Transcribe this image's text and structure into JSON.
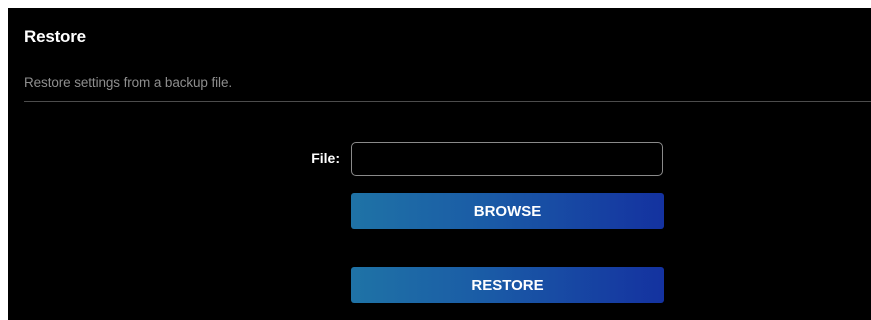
{
  "section": {
    "title": "Restore",
    "description": "Restore settings from a backup file."
  },
  "form": {
    "file_label": "File:",
    "file_value": "",
    "browse_label": "BROWSE",
    "restore_label": "RESTORE"
  },
  "colors": {
    "background": "#000000",
    "title_text": "#ffffff",
    "description_text": "#8e8e8e",
    "button_gradient_start": "#1f73a6",
    "button_gradient_end": "#1432a0"
  }
}
